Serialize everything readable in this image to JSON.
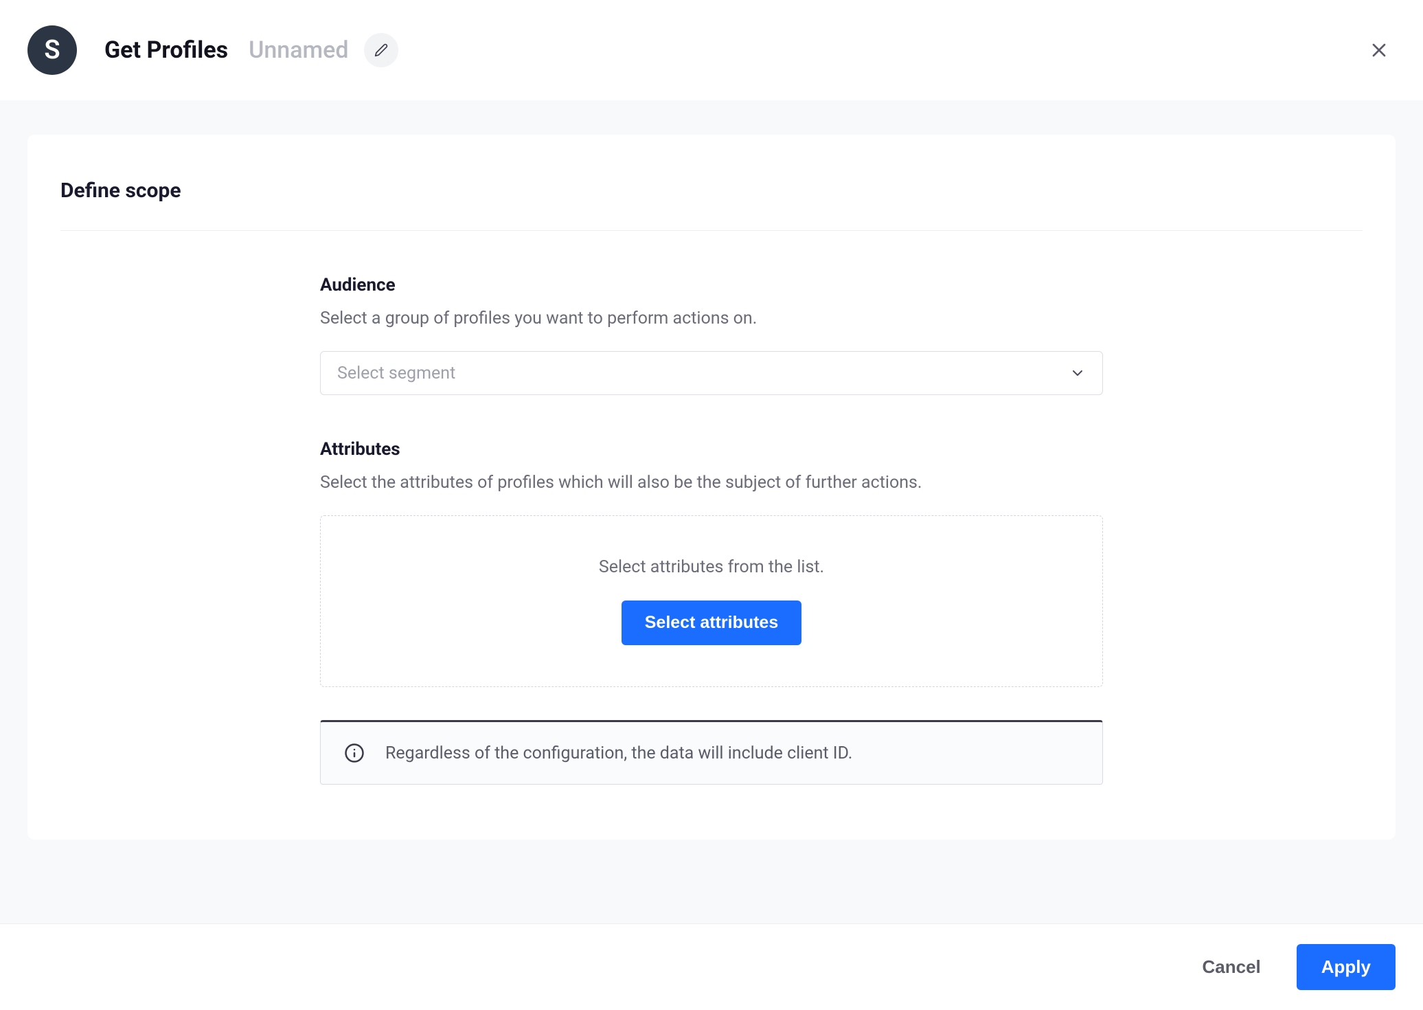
{
  "header": {
    "workspace_letter": "S",
    "title": "Get Profiles",
    "name": "Unnamed"
  },
  "card": {
    "title": "Define scope"
  },
  "audience": {
    "label": "Audience",
    "description": "Select a group of profiles you want to perform actions on.",
    "select_placeholder": "Select segment"
  },
  "attributes": {
    "label": "Attributes",
    "description": "Select the attributes of profiles which will also be the subject of further actions.",
    "empty_text": "Select attributes from the list.",
    "button_label": "Select attributes"
  },
  "info": {
    "text": "Regardless of the configuration, the data will include client ID."
  },
  "footer": {
    "cancel_label": "Cancel",
    "apply_label": "Apply"
  }
}
